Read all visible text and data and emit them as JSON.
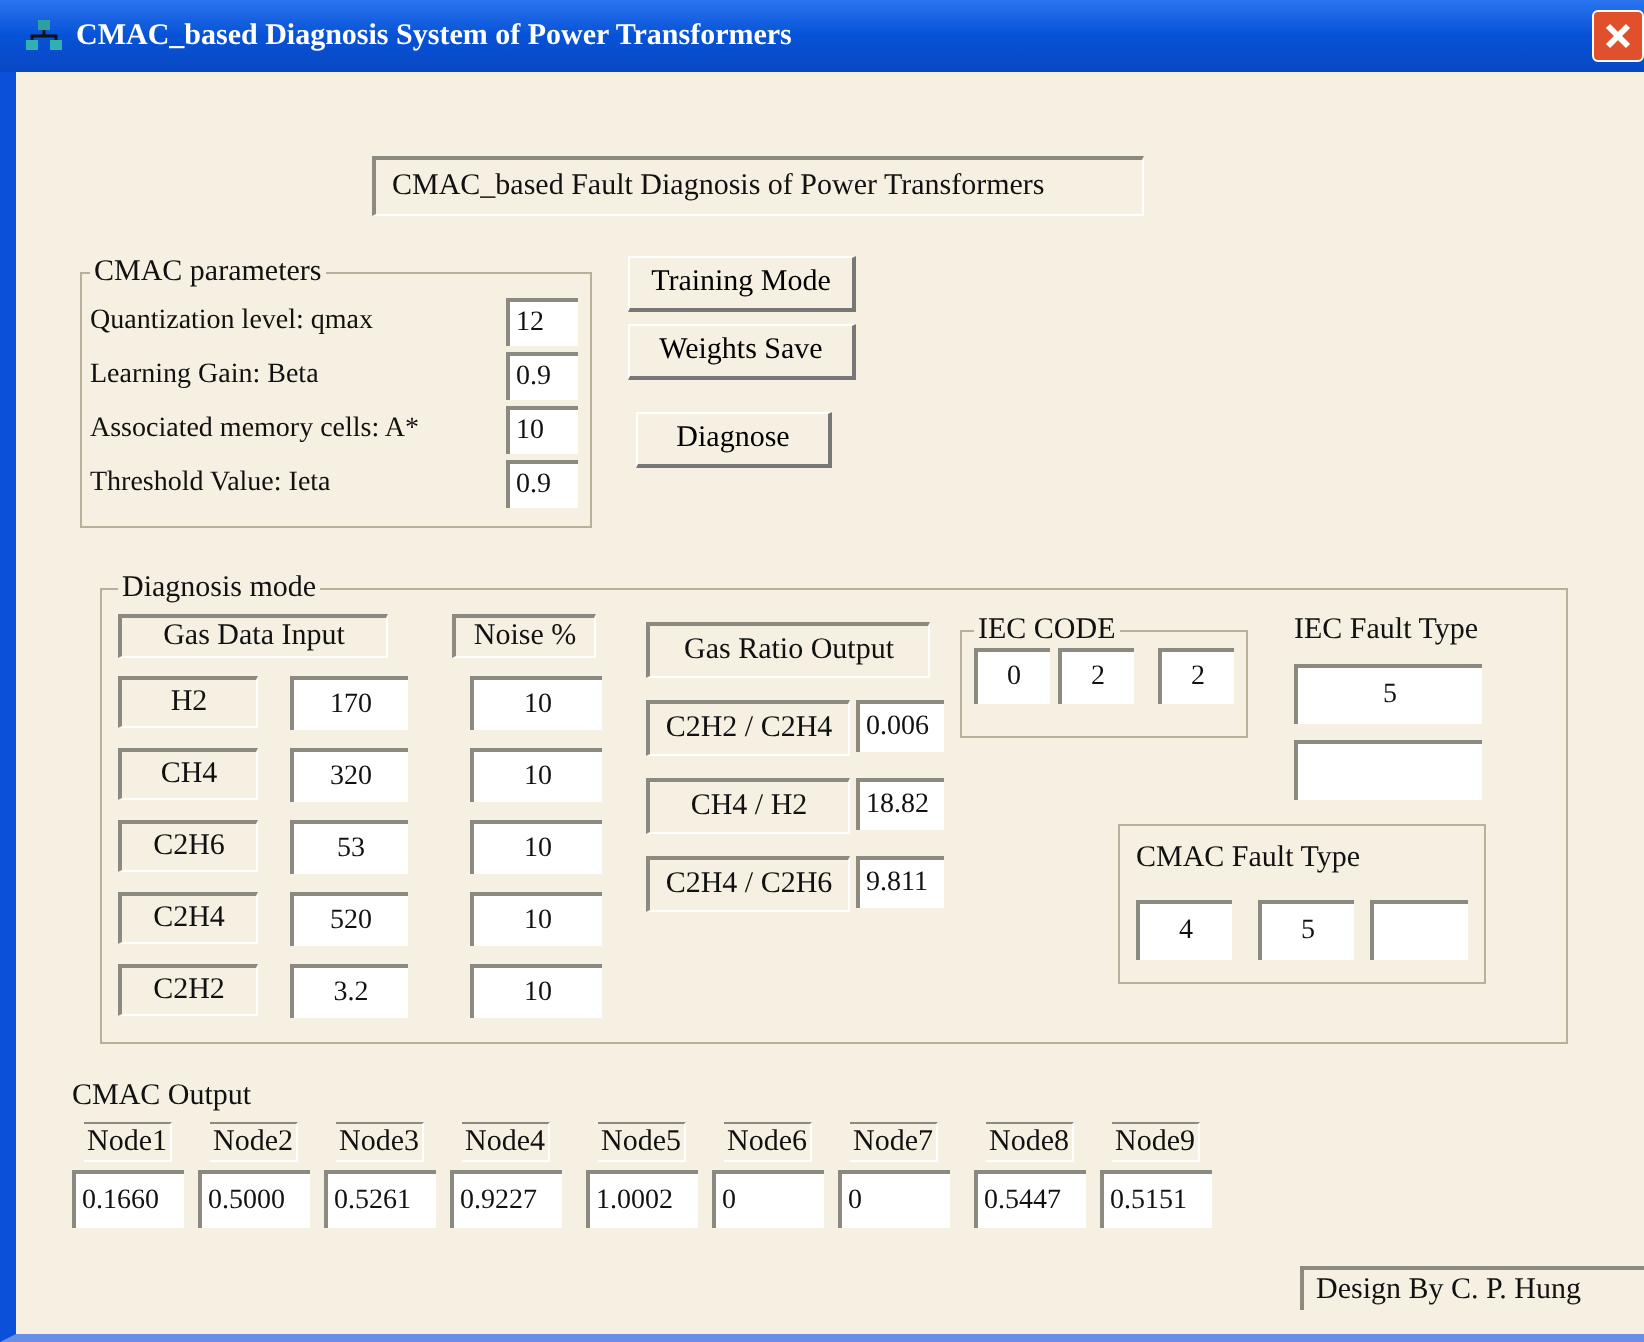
{
  "window": {
    "title": "CMAC_based Diagnosis System of Power Transformers"
  },
  "header": "CMAC_based Fault Diagnosis of Power Transformers",
  "parameters": {
    "title": "CMAC parameters",
    "rows": [
      {
        "label": "Quantization level: qmax",
        "value": "12"
      },
      {
        "label": "Learning Gain: Beta",
        "value": "0.9"
      },
      {
        "label": "Associated memory cells: A*",
        "value": "10"
      },
      {
        "label": "Threshold Value: Ieta",
        "value": "0.9"
      }
    ]
  },
  "buttons": [
    "Training Mode",
    "Weights Save",
    "Diagnose"
  ],
  "diagnosis": {
    "title": "Diagnosis mode",
    "gas_header": "Gas Data Input",
    "noise_header": "Noise %",
    "gases": [
      {
        "name": "H2",
        "value": "170",
        "noise": "10"
      },
      {
        "name": "CH4",
        "value": "320",
        "noise": "10"
      },
      {
        "name": "C2H6",
        "value": "53",
        "noise": "10"
      },
      {
        "name": "C2H4",
        "value": "520",
        "noise": "10"
      },
      {
        "name": "C2H2",
        "value": "3.2",
        "noise": "10"
      }
    ],
    "ratio_header": "Gas Ratio Output",
    "ratios": [
      {
        "label": "C2H2 / C2H4",
        "value": "0.006"
      },
      {
        "label": "CH4 / H2",
        "value": "18.82"
      },
      {
        "label": "C2H4 / C2H6",
        "value": "9.811"
      }
    ],
    "iec_code": {
      "title": "IEC CODE",
      "values": [
        "0",
        "2",
        "2"
      ]
    },
    "iec_fault": {
      "title": "IEC Fault Type",
      "values": [
        "5"
      ]
    },
    "cmac_fault": {
      "title": "CMAC Fault Type",
      "values": [
        "4",
        "5"
      ]
    }
  },
  "cmac_output": {
    "title": "CMAC Output",
    "nodes": [
      {
        "label": "Node1",
        "value": "0.1660"
      },
      {
        "label": "Node2",
        "value": "0.5000"
      },
      {
        "label": "Node3",
        "value": "0.5261"
      },
      {
        "label": "Node4",
        "value": "0.9227"
      },
      {
        "label": "Node5",
        "value": "1.0002"
      },
      {
        "label": "Node6",
        "value": "0"
      },
      {
        "label": "Node7",
        "value": "0"
      },
      {
        "label": "Node8",
        "value": "0.5447"
      },
      {
        "label": "Node9",
        "value": "0.5151"
      }
    ]
  },
  "footer": "Design By C. P. Hung"
}
